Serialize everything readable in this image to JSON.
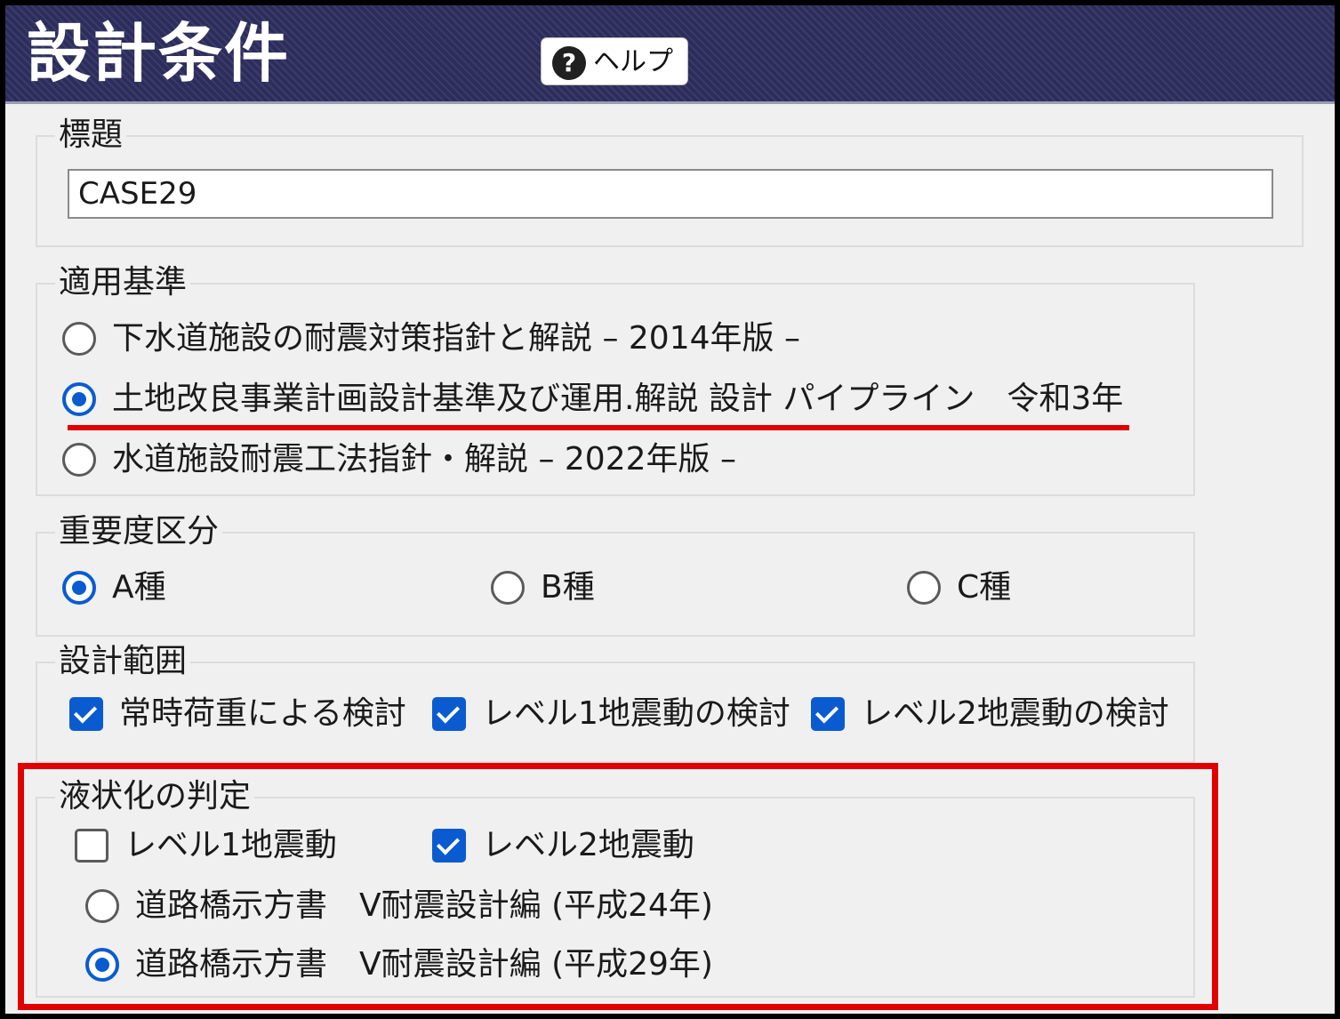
{
  "header": {
    "title": "設計条件",
    "help_label": "ヘルプ",
    "help_icon": "?"
  },
  "title_group": {
    "legend": "標題",
    "value": "CASE29"
  },
  "standard_group": {
    "legend": "適用基準",
    "options": [
      {
        "label": "下水道施設の耐震対策指針と解説 – 2014年版 –",
        "selected": false
      },
      {
        "label": "土地改良事業計画設計基準及び運用.解説 設計 パイプライン　令和3年",
        "selected": true
      },
      {
        "label": "水道施設耐震工法指針・解説 – 2022年版 –",
        "selected": false
      }
    ]
  },
  "importance_group": {
    "legend": "重要度区分",
    "options": [
      {
        "label": "A種",
        "selected": true
      },
      {
        "label": "B種",
        "selected": false
      },
      {
        "label": "C種",
        "selected": false
      }
    ]
  },
  "scope_group": {
    "legend": "設計範囲",
    "options": [
      {
        "label": "常時荷重による検討",
        "checked": true
      },
      {
        "label": "レベル1地震動の検討",
        "checked": true
      },
      {
        "label": "レベル2地震動の検討",
        "checked": true
      }
    ]
  },
  "liquefaction_group": {
    "legend": "液状化の判定",
    "checks": [
      {
        "label": "レベル1地震動",
        "checked": false
      },
      {
        "label": "レベル2地震動",
        "checked": true
      }
    ],
    "radios": [
      {
        "label": "道路橋示方書　V耐震設計編 (平成24年)",
        "selected": false
      },
      {
        "label": "道路橋示方書　V耐震設計編 (平成29年)",
        "selected": true
      }
    ]
  },
  "colors": {
    "header_bg": "#2c2d5c",
    "accent": "#0a5bd0",
    "highlight": "#e00000"
  }
}
